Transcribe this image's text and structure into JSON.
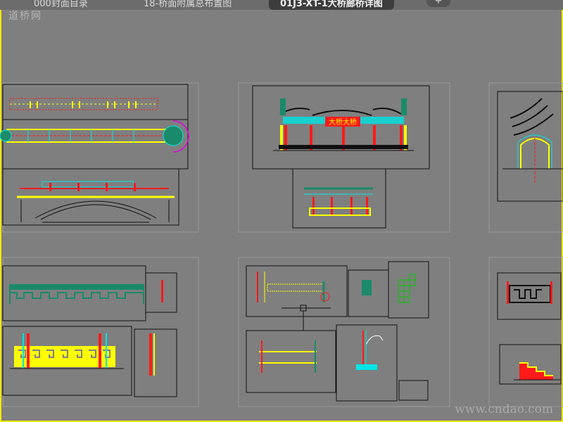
{
  "tabs": [
    {
      "label": "000封面目录"
    },
    {
      "label": "18-桥面附属总布置图"
    },
    {
      "label": "01J3-XT-1大桥廊桥详图"
    }
  ],
  "tab_add_label": "+",
  "watermark_top_left": "道桥网",
  "watermark_bottom_right": "www.cndao.com",
  "sign_text": "大桥大桥",
  "colors": {
    "background": "#7f7f7f",
    "frame": "#f2e600",
    "sheet_border": "#9a9a9a",
    "line": "#101010",
    "cyan": "#00e5e5",
    "yellow": "#ffff00",
    "red": "#ff1a1a",
    "green": "#00c800",
    "teal": "#1a8a6a",
    "magenta": "#e000e0"
  }
}
